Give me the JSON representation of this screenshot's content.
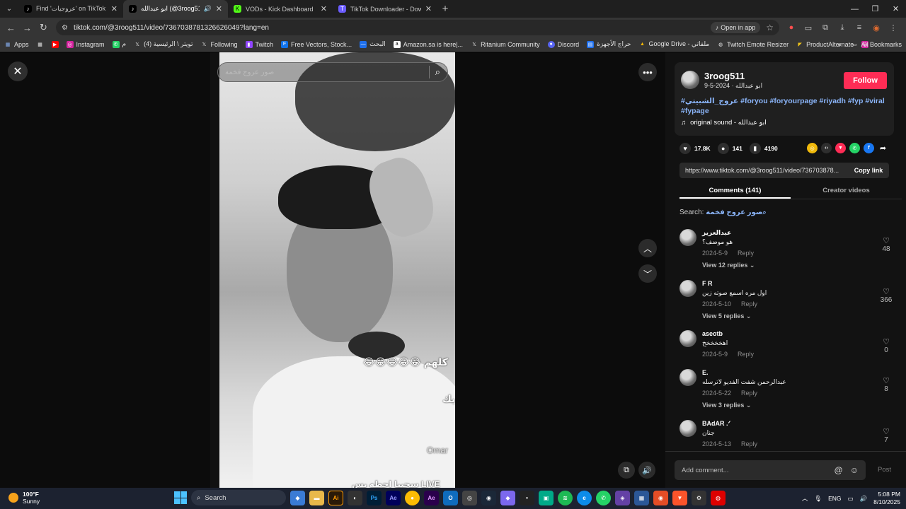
{
  "browser": {
    "tabs": [
      {
        "title": "Find 'عروجيات' on TikTok | TikTok",
        "favicon": "T",
        "active": false
      },
      {
        "title": "ابو عبدالله (@3roog511) | TikTok",
        "favicon": "T",
        "active": true,
        "audio": true
      },
      {
        "title": "VODs - Kick Dashboard",
        "favicon": "K",
        "active": false
      },
      {
        "title": "TikTok Downloader - Download",
        "favicon": "T",
        "active": false
      }
    ],
    "url": "tiktok.com/@3roog511/video/7367038781326626049?lang=en",
    "open_in_app": "Open in app",
    "bookmarks": [
      "Apps",
      "",
      "Instagram",
      "م",
      "تويتر \\ الرئيسية (4)",
      "Following",
      "Twitch",
      "Free Vectors, Stock...",
      "البحث",
      "Amazon.sa is here|...",
      "Ritanium Community",
      "Discord",
      "حراج الأجهزة",
      "Google Drive - ملفاتي",
      "Twitch Emote Resizer",
      "ProductAlternate",
      ""
    ],
    "all_bookmarks": "All Bookmarks"
  },
  "video": {
    "search_placeholder": "صور عروج فخمة",
    "overlay_text_1": "😂😂😂😂😂 كلهم",
    "overlay_text_2": "يك",
    "watermark": "Omar",
    "bottom_text": "سحبيا احطه بس LIVE"
  },
  "post": {
    "username": "3roog511",
    "subtitle": "ابو عبدالله · 2024-5-9",
    "follow_label": "Follow",
    "hashtags": "#عروج_الشبيتي #foryou #foryourpage #riyadh #fyp #viral #fypage",
    "sound": "original sound - ابو عبدالله",
    "likes": "17.8K",
    "comments_count": "141",
    "saves": "4190",
    "link": "https://www.tiktok.com/@3roog511/video/736703878...",
    "copy_link": "Copy link"
  },
  "tabs": {
    "comments": "Comments (141)",
    "creator_videos": "Creator videos"
  },
  "comment_search": {
    "label": "Search:",
    "query": "صور عروج فخمة"
  },
  "comments": [
    {
      "name": "عبدالعزيز",
      "text": "هو موضف؟",
      "date": "2024-5-9",
      "reply": "Reply",
      "likes": "48",
      "views": "View 12 replies"
    },
    {
      "name": "F R",
      "text": "اول مره اسمع صوته زين",
      "date": "2024-5-10",
      "reply": "Reply",
      "likes": "366",
      "views": "View 5 replies"
    },
    {
      "name": "aseotb",
      "text": "اهخخخخخ",
      "date": "2024-5-9",
      "reply": "Reply",
      "likes": "0",
      "views": ""
    },
    {
      "name": "E.",
      "text": "عبدالرحمن شفت الفديو لاترسله",
      "date": "2024-5-22",
      "reply": "Reply",
      "likes": "8",
      "views": "View 3 replies"
    },
    {
      "name": "BAdAR .ᐟ",
      "text": "جنان",
      "date": "2024-5-13",
      "reply": "Reply",
      "likes": "7",
      "views": ""
    }
  ],
  "add_comment": {
    "placeholder": "Add comment...",
    "post": "Post"
  },
  "taskbar": {
    "temp": "100°F",
    "weather": "Sunny",
    "search": "Search",
    "lang": "ENG",
    "time": "5:08 PM",
    "date": "8/10/2025"
  }
}
